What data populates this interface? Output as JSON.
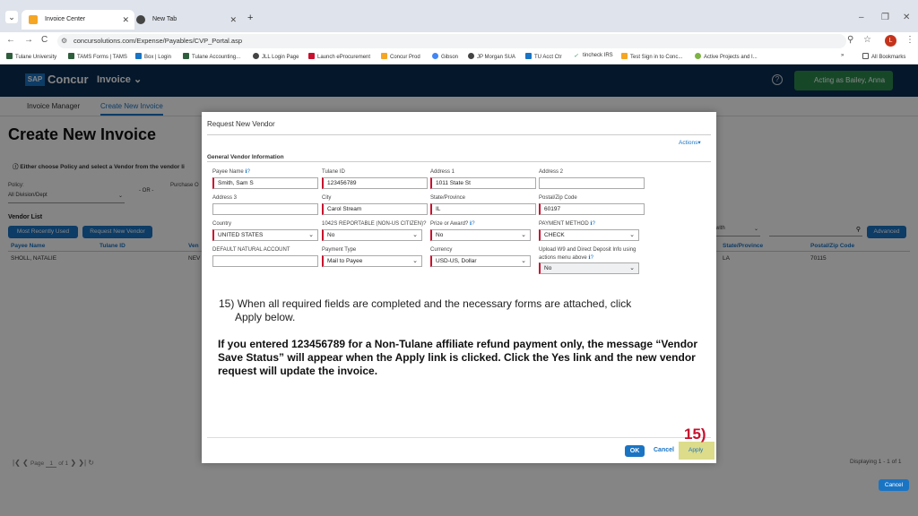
{
  "browser": {
    "tabs": [
      {
        "title": "Invoice Center",
        "active": true
      },
      {
        "title": "New Tab",
        "active": false
      }
    ],
    "url": "concursolutions.com/Expense/Payables/CVP_Portal.asp",
    "profile_initial": "L",
    "bookmarks": [
      "Tulane University",
      "TAMS Forms | TAMS",
      "Box | Login",
      "Tulane Accounting...",
      "JLL Login Page",
      "Launch eProcurement",
      "Concur Prod",
      "Gibson",
      "JP Morgan SUA",
      "TU Acct Ctr",
      "tincheck IRS",
      "Test Sign in to Conc...",
      "Active Projects and I..."
    ],
    "all_bookmarks": "All Bookmarks"
  },
  "app": {
    "brand_sap": "SAP",
    "brand_concur": "Concur",
    "module_menu": "Invoice",
    "acting_as": "Acting as Bailey, Anna",
    "subnav": [
      "Invoice Manager",
      "Create New Invoice"
    ],
    "page_title": "Create New Invoice",
    "info_text": "Either choose Policy and select a Vendor from the vendor li",
    "policy_label": "Policy:",
    "policy_value": "All Division/Dept",
    "po_label": "Purchase O",
    "or_label": "- OR -",
    "vendor_list_title": "Vendor List",
    "btn_most_recent": "Most Recently Used",
    "btn_request_vendor": "Request New Vendor",
    "btn_advanced": "Advanced",
    "right_select": "with",
    "grid_headers": [
      "Payee Name",
      "Tulane ID",
      "Ven",
      "State/Province",
      "Postal/Zip Code"
    ],
    "grid_row": [
      "SHOLL, NATALIE",
      "",
      "NEV",
      "LA",
      "70115"
    ],
    "pager_page_label": "Page",
    "pager_page_value": "1",
    "pager_of": "of 1",
    "displaying": "Displaying 1 - 1 of 1",
    "cancel_button": "Cancel"
  },
  "modal": {
    "title": "Request New Vendor",
    "actions": "Actions",
    "section": "General Vendor Information",
    "fields": {
      "payee_name": {
        "label": "Payee Name",
        "value": "Smith, Sam S"
      },
      "tulane_id": {
        "label": "Tulane ID",
        "value": "123456789"
      },
      "address1": {
        "label": "Address 1",
        "value": "1011 State St"
      },
      "address2": {
        "label": "Address 2",
        "value": ""
      },
      "address3": {
        "label": "Address 3",
        "value": ""
      },
      "city": {
        "label": "City",
        "value": "Carol Stream"
      },
      "state": {
        "label": "State/Province",
        "value": "IL"
      },
      "postal": {
        "label": "Postal/Zip Code",
        "value": "60197"
      },
      "country": {
        "label": "Country",
        "value": "UNITED STATES"
      },
      "reportable": {
        "label": "1042S REPORTABLE (NON-US CITIZEN)?",
        "value": "No"
      },
      "prize": {
        "label": "Prize or Award?",
        "value": "No"
      },
      "payment_method": {
        "label": "PAYMENT METHOD",
        "value": "CHECK"
      },
      "default_account": {
        "label": "DEFAULT NATURAL ACCOUNT",
        "value": ""
      },
      "payment_type": {
        "label": "Payment Type",
        "value": "Mail to Payee"
      },
      "currency": {
        "label": "Currency",
        "value": "USD-US, Dollar"
      },
      "upload_w9": {
        "label1": "Upload W9 and Direct Deposit Info using",
        "label2": "actions menu above",
        "value": "No"
      }
    },
    "instruction_num": "15)",
    "instruction_line1": "When all required fields are completed and the  necessary forms are attached, click",
    "instruction_line2": "Apply below.",
    "instruction_bold": "If you entered 123456789 for a Non-Tulane affiliate refund payment only, the message “Vendor Save Status” will appear when the Apply link is clicked.  Click the Yes link and the new vendor request will update the invoice.",
    "ok": "OK",
    "cancel": "Cancel",
    "apply": "Apply"
  },
  "annotation": {
    "step": "15)",
    "color": "#c8102e"
  },
  "colors": {
    "accent": "#1a74c4",
    "header": "#0b2c52",
    "required": "#c8102e",
    "acting": "#2b8a4e",
    "highlight": "#dcdc8a"
  }
}
